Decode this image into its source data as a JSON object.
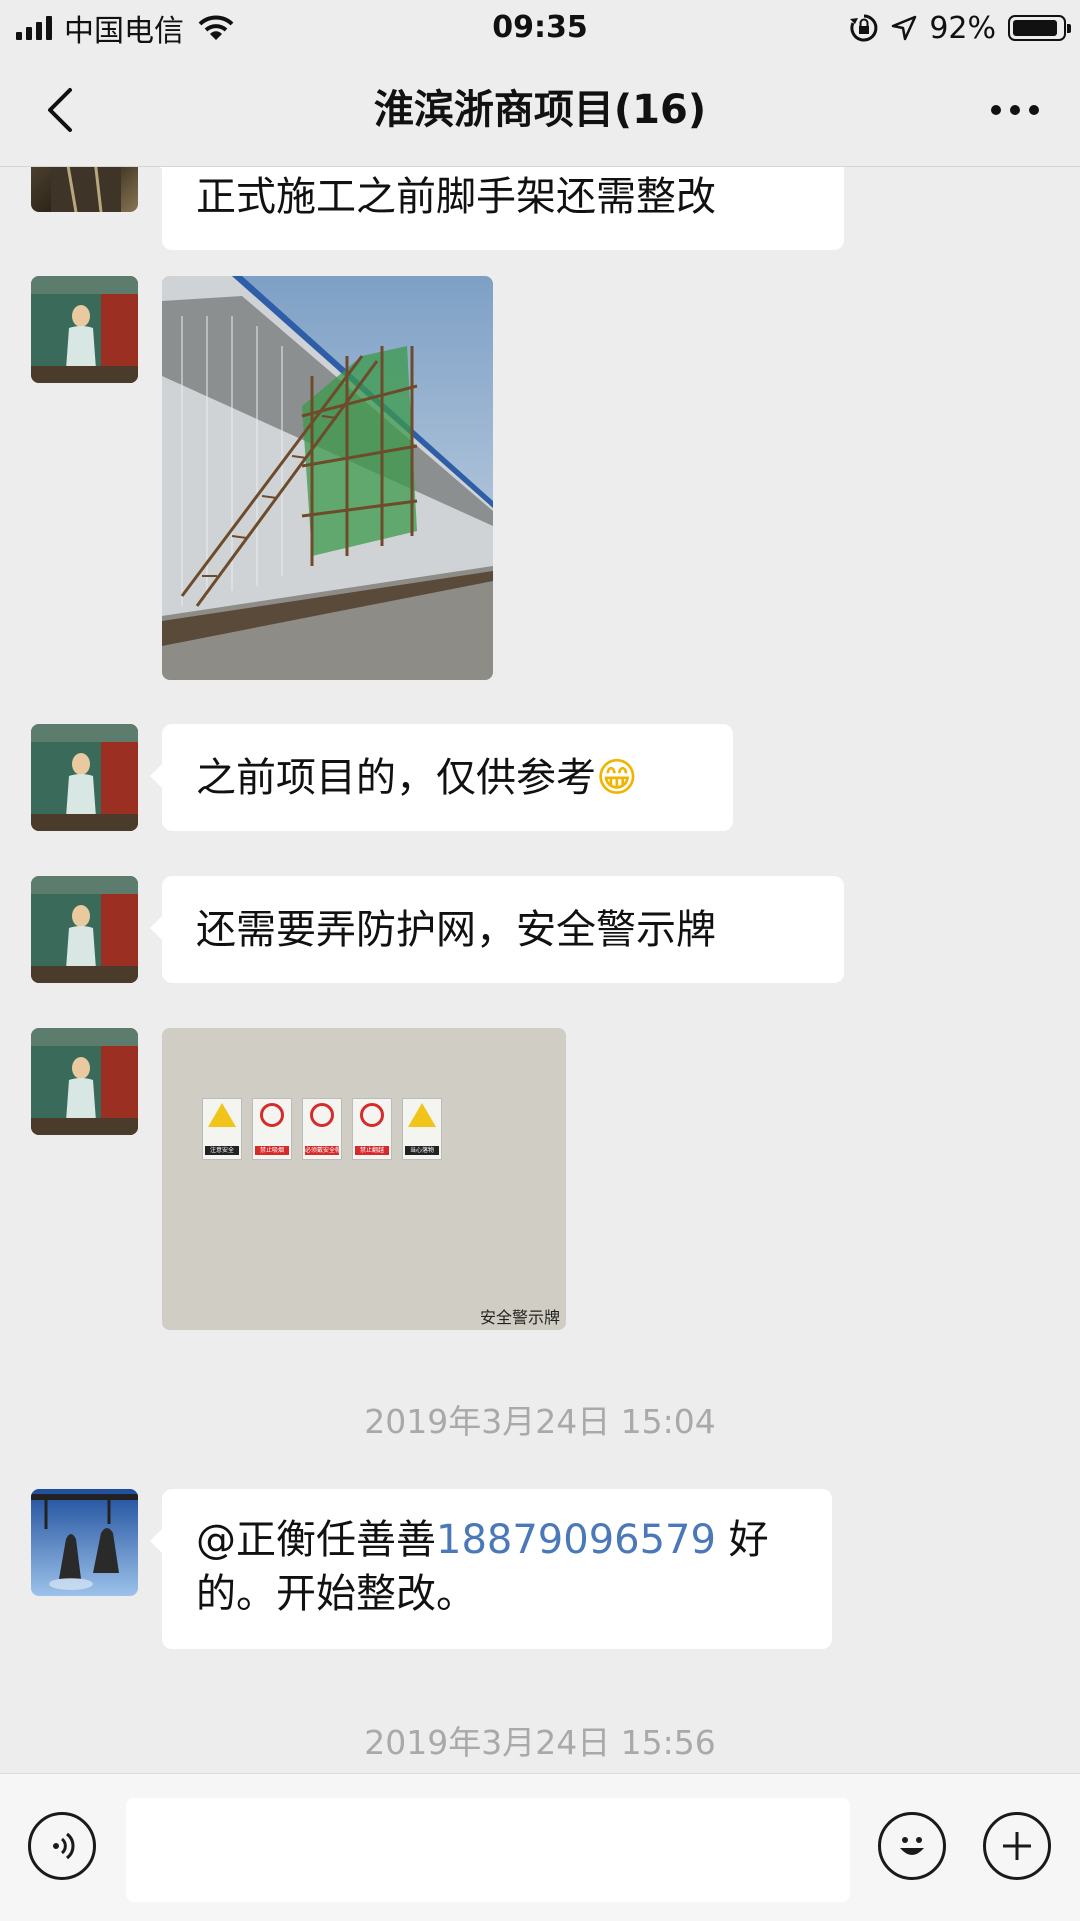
{
  "status_bar": {
    "carrier": "中国电信",
    "time": "09:35",
    "battery_percent": "92%",
    "battery_level": 0.92
  },
  "nav": {
    "title": "淮滨浙商项目(16)"
  },
  "messages": {
    "m0_text": "正式施工之前脚手架还需整改",
    "m2_text": "之前项目的，仅供参考",
    "m2_emoji": "😁",
    "m3_text": "还需要弄防护网，安全警示牌",
    "m4_caption": "安全警示牌",
    "ts1": "2019年3月24日 15:04",
    "m5_mention": "@正衡任善善",
    "m5_phone": "18879096579",
    "m5_line1_end": " 好",
    "m5_line2": "的。开始整改。",
    "ts2": "2019年3月24日 15:56"
  },
  "signs": [
    {
      "label": "注意安全",
      "color": "#f0c419"
    },
    {
      "label": "禁止吸烟",
      "color": "#d62b2b"
    },
    {
      "label": "必须戴安全帽",
      "color": "#d62b2b"
    },
    {
      "label": "禁止翻越",
      "color": "#d62b2b"
    },
    {
      "label": "当心落物",
      "color": "#f0c419"
    }
  ],
  "input": {
    "placeholder": ""
  },
  "icons": [
    "back-arrow-icon",
    "more-dots-icon",
    "voice-icon",
    "emoji-icon",
    "plus-icon",
    "wifi-icon",
    "signal-icon",
    "lock-rotation-icon",
    "location-arrow-icon",
    "battery-icon"
  ]
}
